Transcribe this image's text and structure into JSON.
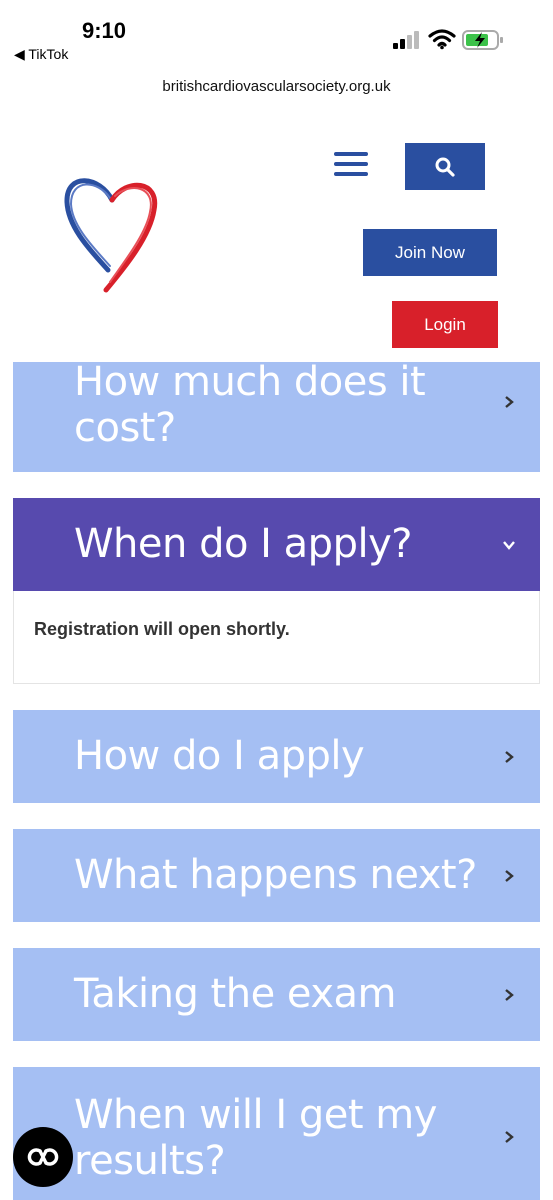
{
  "status_bar": {
    "time": "9:10",
    "back_app": "◀ TikTok"
  },
  "browser": {
    "url": "britishcardiovascularsociety.org.uk"
  },
  "header": {
    "logo_icon": "heart-logo-icon",
    "menu_icon": "hamburger-menu-icon",
    "search_icon": "search-icon",
    "join_label": "Join Now",
    "login_label": "Login",
    "colors": {
      "brand_blue": "#2a4fa0",
      "brand_red": "#d8202a"
    }
  },
  "accordion": {
    "colors": {
      "collapsed": "#a5bff3",
      "active": "#574aae"
    },
    "items": [
      {
        "title": "How much does it cost?",
        "expanded": false
      },
      {
        "title": "When do I apply?",
        "expanded": true,
        "content": "Registration will open shortly."
      },
      {
        "title": "How do I apply",
        "expanded": false
      },
      {
        "title": "What happens next?",
        "expanded": false
      },
      {
        "title": "Taking the exam",
        "expanded": false
      },
      {
        "title": "When will I get my results?",
        "expanded": false
      }
    ]
  },
  "floating_button": {
    "icon": "accessibility-icon"
  }
}
